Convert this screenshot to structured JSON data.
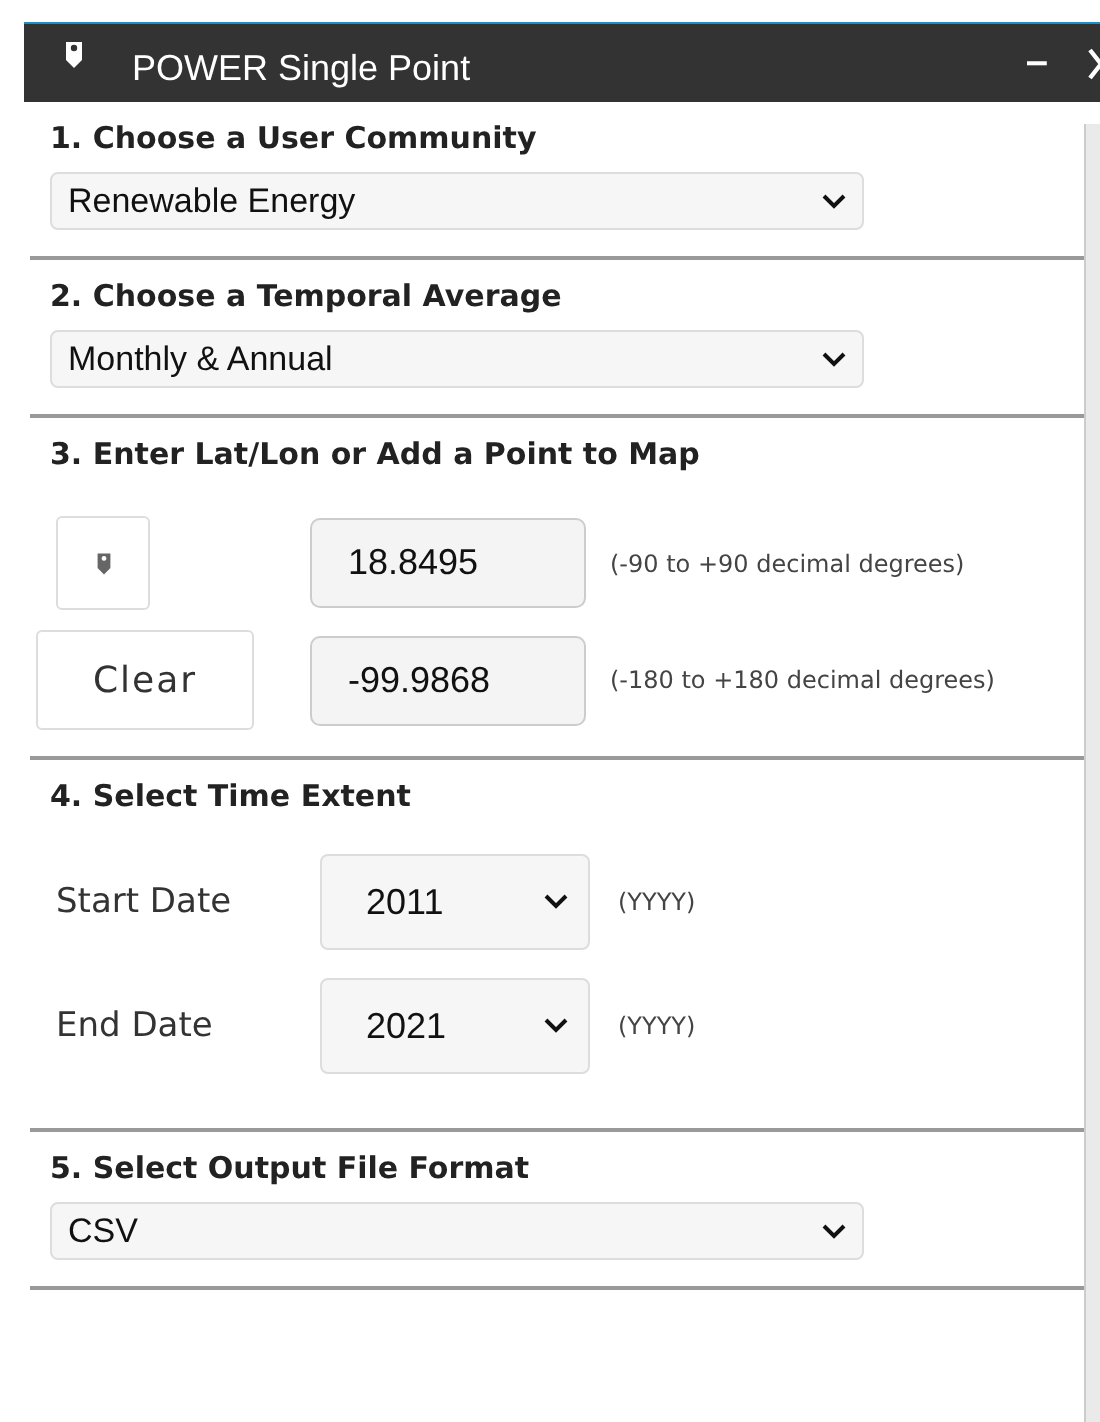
{
  "window": {
    "title": "POWER Single Point",
    "minimize": "–"
  },
  "community": {
    "heading": "1. Choose a User Community",
    "value": "Renewable Energy"
  },
  "temporal": {
    "heading": "2. Choose a Temporal Average",
    "value": "Monthly & Annual"
  },
  "location": {
    "heading": "3. Enter Lat/Lon or Add a Point to Map",
    "clear": "Clear",
    "latitude": "18.8495",
    "latitude_hint": "(-90 to +90 decimal degrees)",
    "longitude": "-99.9868",
    "longitude_hint": "(-180 to +180 decimal degrees)"
  },
  "time": {
    "heading": "4. Select Time Extent",
    "rows": [
      {
        "label": "Start Date",
        "value": "2011",
        "hint": "(YYYY)"
      },
      {
        "label": "End Date",
        "value": "2021",
        "hint": "(YYYY)"
      }
    ]
  },
  "format": {
    "heading": "5. Select Output File Format",
    "value": "CSV"
  }
}
